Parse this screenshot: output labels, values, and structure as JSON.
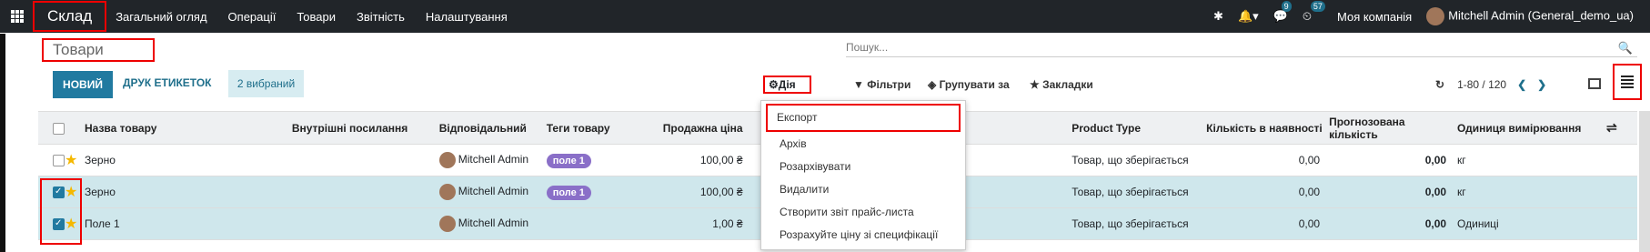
{
  "topbar": {
    "app_name": "Склад",
    "menu": [
      "Загальний огляд",
      "Операції",
      "Товари",
      "Звітність",
      "Налаштування"
    ],
    "messages_count": "9",
    "activities_count": "57",
    "company": "Моя компанія",
    "user": "Mitchell Admin (General_demo_ua)"
  },
  "breadcrumb": "Товари",
  "search": {
    "placeholder": "Пошук..."
  },
  "buttons": {
    "new": "НОВИЙ",
    "print": "ДРУК ЕТИКЕТОК",
    "selected": "2 вибраний"
  },
  "controls": {
    "action": "Дія",
    "filters": "Фільтри",
    "group_by": "Групувати за",
    "favorites": "Закладки",
    "pager": "1-80 / 120"
  },
  "table": {
    "columns": [
      "Назва товару",
      "Внутрішні посилання",
      "Відповідальний",
      "Теги товару",
      "Продажна ціна",
      "Product Type",
      "Кількість в наявності",
      "Прогнозована кількість",
      "Одиниця вимірювання"
    ],
    "rows": [
      {
        "name": "Зерно",
        "responsible": "Mitchell Admin",
        "tag": "поле 1",
        "price": "100,00 ₴",
        "type": "Товар, що зберігається",
        "qty": "0,00",
        "forecast": "0,00",
        "uom": "кг",
        "checked": false
      },
      {
        "name": "Зерно",
        "responsible": "Mitchell Admin",
        "tag": "поле 1",
        "price": "100,00 ₴",
        "type": "Товар, що зберігається",
        "qty": "0,00",
        "forecast": "0,00",
        "uom": "кг",
        "checked": true
      },
      {
        "name": "Поле 1",
        "responsible": "Mitchell Admin",
        "tag": "",
        "price": "1,00 ₴",
        "type": "Товар, що зберігається",
        "qty": "0,00",
        "forecast": "0,00",
        "uom": "Одиниці",
        "checked": true
      }
    ]
  },
  "dropdown": [
    "Експорт",
    "Архів",
    "Розархівувати",
    "Видалити",
    "Створити звіт прайс-листа",
    "Розрахуйте ціну зі специфікації"
  ],
  "colors": {
    "topbar": "#212529",
    "accent": "#217aa0",
    "highlight": "#e00000",
    "tag": "#8a6fc8"
  }
}
